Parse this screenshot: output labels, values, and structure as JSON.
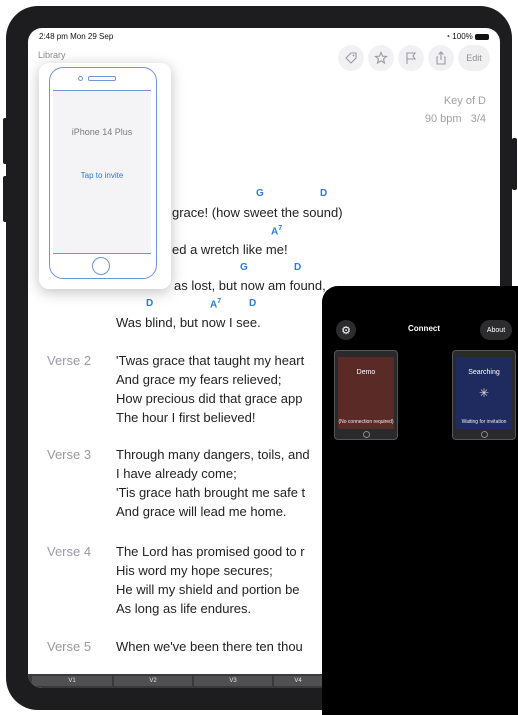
{
  "status_bar": {
    "time": "2:48 pm  Mon 29 Sep",
    "battery": "100%"
  },
  "nav": {
    "library": "Library",
    "edit": "Edit"
  },
  "toolbar_icons": [
    "tag-icon",
    "star-icon",
    "flag-icon",
    "share-icon"
  ],
  "song_meta": {
    "key": "Key of D",
    "tempo": "90 bpm",
    "time_signature": "3/4"
  },
  "verse1": {
    "chords_line1": [
      "G",
      "D"
    ],
    "line1": "grace! (how sweet the sound)",
    "chord_line2": "A",
    "chord_line2_sup": "7",
    "line2": "ed a wretch like me!",
    "chords_line3": [
      "G",
      "D"
    ],
    "line3": "as lost, but now am found,",
    "chords_line4": [
      "D",
      "A",
      "D"
    ],
    "chord_line4_sup": "7",
    "line4": "Was blind, but now I see."
  },
  "verses": [
    {
      "label": "Verse 2",
      "lines": [
        "'Twas grace that taught my heart",
        "And grace my fears relieved;",
        "How precious did that grace app",
        "The hour I first believed!"
      ]
    },
    {
      "label": "Verse 3",
      "lines": [
        "Through many dangers, toils, and",
        "I have already come;",
        "'Tis grace hath brought me safe t",
        "And grace will lead me home."
      ]
    },
    {
      "label": "Verse 4",
      "lines": [
        "The Lord has promised good to r",
        "His word my hope secures;",
        "He will my shield and portion be",
        "As long as life endures."
      ]
    },
    {
      "label": "Verse 5",
      "lines": [
        "When we've been there ten thou"
      ]
    }
  ],
  "invite_popover": {
    "device_name": "iPhone 14 Plus",
    "invite_text": "Tap to invite"
  },
  "bottom_tabs": [
    "V1",
    "V2",
    "V3",
    "V4"
  ],
  "connect_panel": {
    "title": "Connect",
    "about": "About",
    "devices": [
      {
        "name": "Demo",
        "status": "(No connection required)",
        "color": "#5a2b26"
      },
      {
        "name": "Searching",
        "status": "Waiting for invitation",
        "color": "#1f2a5e"
      }
    ]
  },
  "colors": {
    "chord": "#2d7bd6",
    "frame": "#1d1d1f",
    "panel": "#000000"
  }
}
